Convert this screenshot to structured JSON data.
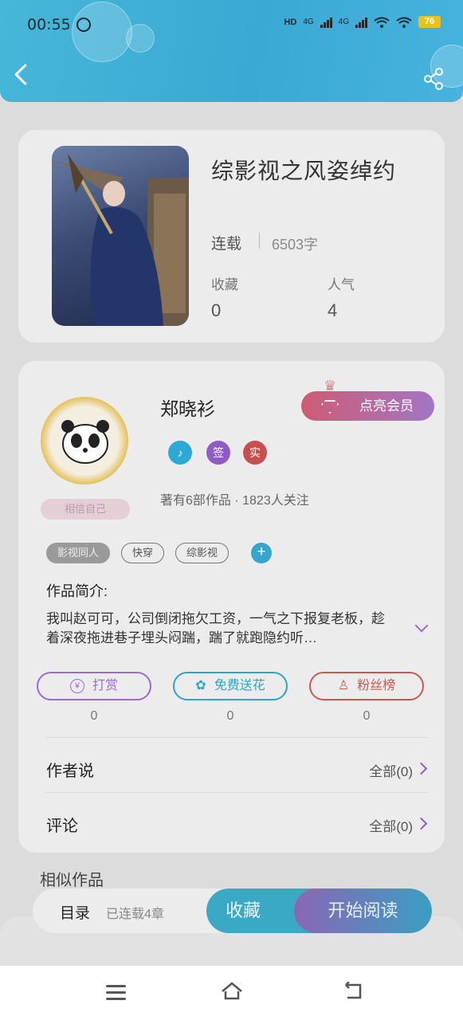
{
  "status_bar": {
    "time": "00:55",
    "network1": "4G",
    "network2": "4G",
    "battery": "76"
  },
  "book": {
    "title": "综影视之风姿绰约",
    "serial_status": "连载",
    "word_count": "6503字",
    "favorites_label": "收藏",
    "favorites_value": "0",
    "popularity_label": "人气",
    "popularity_value": "4"
  },
  "author": {
    "name": "郑晓衫",
    "avatar_tag": "相信自己",
    "vip_button": "点亮会员",
    "badges": [
      {
        "text": "♪",
        "color": "#2ba9d8"
      },
      {
        "text": "签",
        "color": "#8f5bc4"
      },
      {
        "text": "实",
        "color": "#c94e4e"
      }
    ],
    "meta": "著有6部作品 · 1823人关注"
  },
  "tags": [
    "影视同人",
    "快穿",
    "综影视"
  ],
  "intro": {
    "label": "作品简介:",
    "text": "我叫赵可可，公司倒闭拖欠工资，一气之下报复老板，趁着深夜拖进巷子埋头闷踹，踹了就跑隐约听…"
  },
  "actions": [
    {
      "label": "打赏",
      "count": "0",
      "color": "#9a6bd1"
    },
    {
      "label": "免费送花",
      "count": "0",
      "color": "#2ba6c6"
    },
    {
      "label": "粉丝榜",
      "count": "0",
      "color": "#d0574f"
    }
  ],
  "author_says": {
    "label": "作者说",
    "more": "全部(0)"
  },
  "comments": {
    "label": "评论",
    "more": "全部(0)"
  },
  "similar": {
    "label": "相似作品"
  },
  "bottom_bar": {
    "toc": "目录",
    "chapters": "已连载4章",
    "collect": "收藏",
    "read": "开始阅读"
  }
}
